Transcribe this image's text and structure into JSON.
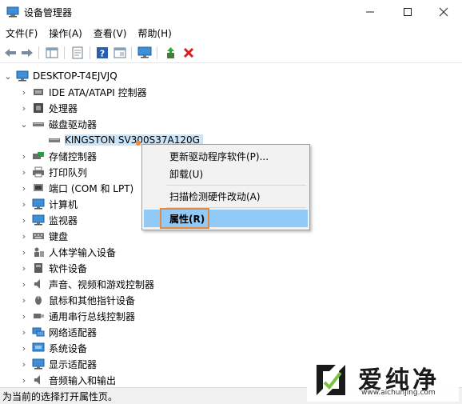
{
  "window": {
    "title": "设备管理器"
  },
  "menu": [
    "文件(F)",
    "操作(A)",
    "查看(V)",
    "帮助(H)"
  ],
  "tree": {
    "root": "DESKTOP-T4EJVJQ",
    "items": [
      {
        "label": "IDE ATA/ATAPI 控制器",
        "expanded": false
      },
      {
        "label": "处理器",
        "expanded": false
      },
      {
        "label": "磁盘驱动器",
        "expanded": true
      },
      {
        "label": "KINGSTON SV300S37A120G",
        "selected": true
      },
      {
        "label": "存储控制器",
        "expanded": false
      },
      {
        "label": "打印队列",
        "expanded": false
      },
      {
        "label": "端口 (COM 和 LPT)",
        "expanded": false
      },
      {
        "label": "计算机",
        "expanded": false
      },
      {
        "label": "监视器",
        "expanded": false
      },
      {
        "label": "键盘",
        "expanded": false
      },
      {
        "label": "人体学输入设备",
        "expanded": false
      },
      {
        "label": "软件设备",
        "expanded": false
      },
      {
        "label": "声音、视频和游戏控制器",
        "expanded": false
      },
      {
        "label": "鼠标和其他指针设备",
        "expanded": false
      },
      {
        "label": "通用串行总线控制器",
        "expanded": false
      },
      {
        "label": "网络适配器",
        "expanded": false
      },
      {
        "label": "系统设备",
        "expanded": false
      },
      {
        "label": "显示适配器",
        "expanded": false
      },
      {
        "label": "音频输入和输出",
        "expanded": false
      }
    ]
  },
  "context_menu": {
    "update_driver": "更新驱动程序软件(P)...",
    "uninstall": "卸载(U)",
    "scan": "扫描检测硬件改动(A)",
    "properties": "属性(R)"
  },
  "status": "为当前的选择打开属性页。",
  "watermark": {
    "title": "爱纯净",
    "url": "www.aichunjing.com"
  },
  "colors": {
    "selection": "#cce4f7",
    "menu_highlight": "#91c9f7",
    "highlight_box": "#e8893a",
    "delete_x": "#d81e1e"
  }
}
